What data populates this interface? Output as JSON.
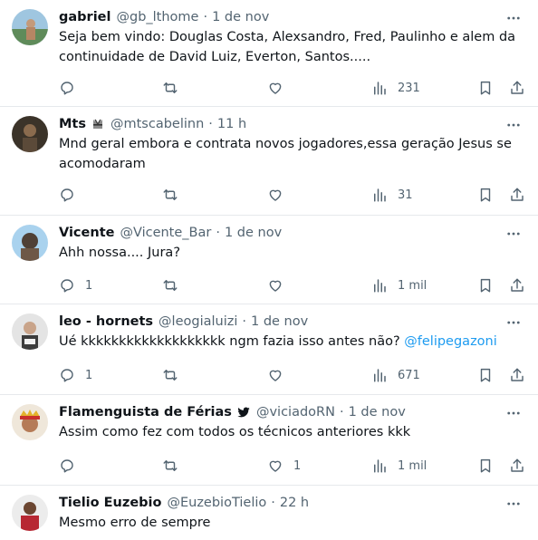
{
  "tweets": [
    {
      "name": "gabriel",
      "handle": "@gb_lthome",
      "time": "1 de nov",
      "text": "Seja bem vindo: Douglas Costa, Alexsandro, Fred, Paulinho e alem da continuidade de David Luiz, Everton, Santos.....",
      "reply_count": "",
      "retweet_count": "",
      "like_count": "",
      "view_count": "231"
    },
    {
      "name": "Mts",
      "handle": "@mtscabelinn",
      "time": "11 h",
      "text": "Mnd geral embora e contrata novos jogadores,essa geração Jesus se acomodaram",
      "reply_count": "",
      "retweet_count": "",
      "like_count": "",
      "view_count": "31"
    },
    {
      "name": "Vicente",
      "handle": "@Vicente_Bar",
      "time": "1 de nov",
      "text": "Ahh nossa.... Jura?",
      "reply_count": "1",
      "retweet_count": "",
      "like_count": "",
      "view_count": "1 mil"
    },
    {
      "name": "leo - hornets",
      "handle": "@leogialuizi",
      "time": "1 de nov",
      "text": "Ué kkkkkkkkkkkkkkkkkkk ngm fazia isso antes não?",
      "mention": "@felipegazoni",
      "reply_count": "1",
      "retweet_count": "",
      "like_count": "",
      "view_count": "671"
    },
    {
      "name": "Flamenguista de Férias",
      "handle": "@viciadoRN",
      "time": "1 de nov",
      "text": "Assim como fez com todos os técnicos anteriores kkk",
      "reply_count": "",
      "retweet_count": "",
      "like_count": "1",
      "view_count": "1 mil"
    },
    {
      "name": "Tielio Euzebio",
      "handle": "@EuzebioTielio",
      "time": "22 h",
      "text": "Mesmo erro de sempre"
    }
  ],
  "colors": {
    "text": "#0f1419",
    "secondary": "#536471",
    "link": "#1d9bf0",
    "divider": "#e6e9ec"
  }
}
